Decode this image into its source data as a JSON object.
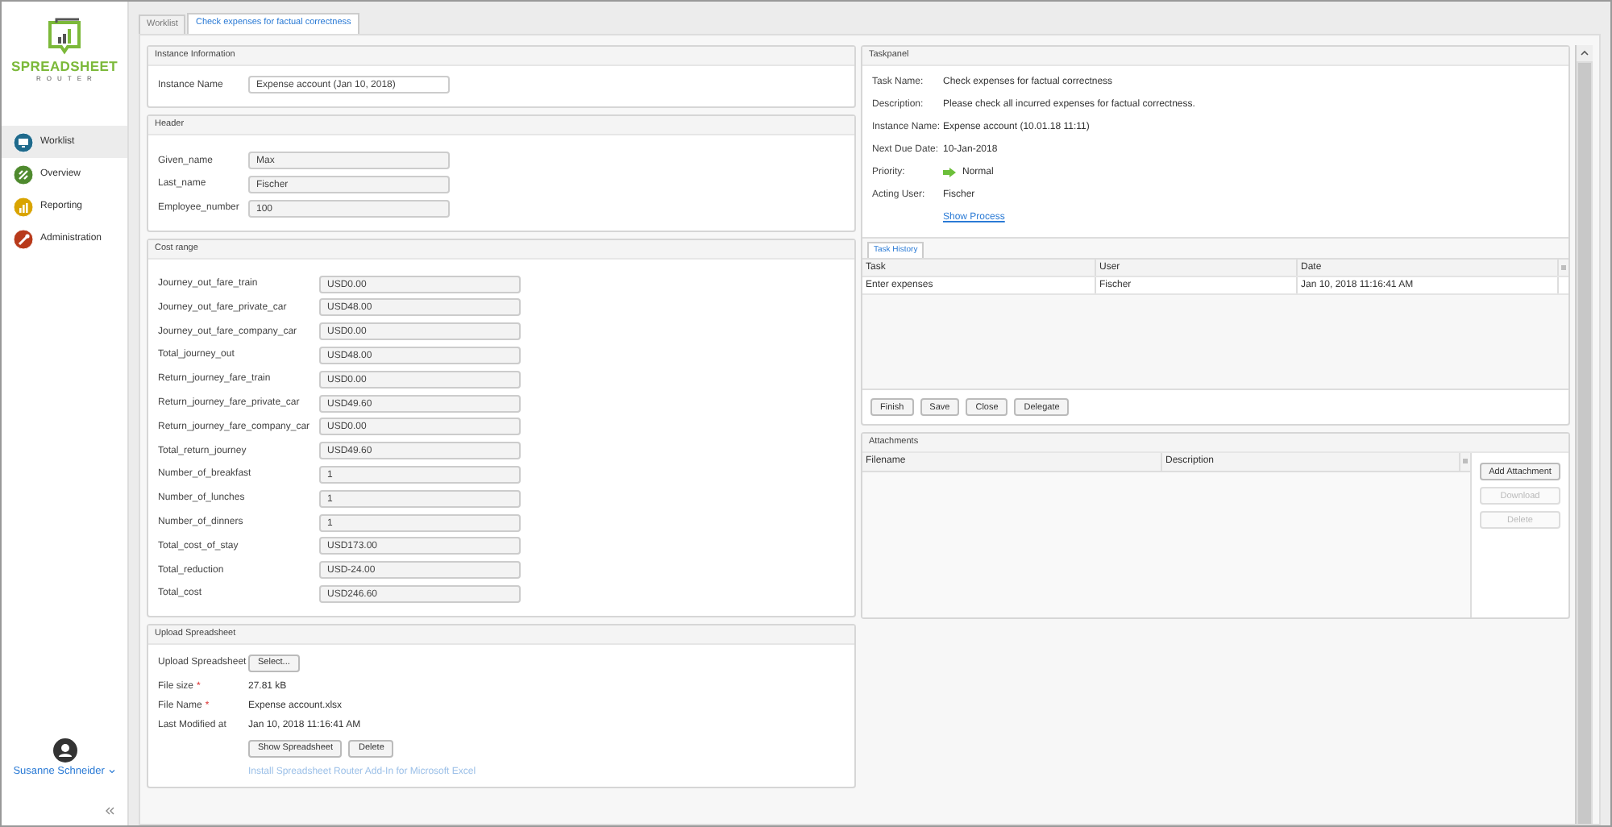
{
  "logo": {
    "title": "SPREADSHEET",
    "subtitle": "ROUTER"
  },
  "sidebar": {
    "items": [
      {
        "label": "Worklist",
        "color": "#1f6a8c",
        "selected": true
      },
      {
        "label": "Overview",
        "color": "#4f8a2e",
        "selected": false
      },
      {
        "label": "Reporting",
        "color": "#d9a400",
        "selected": false
      },
      {
        "label": "Administration",
        "color": "#b83a1b",
        "selected": false
      }
    ]
  },
  "user": {
    "name": "Susanne Schneider"
  },
  "tabs": [
    {
      "label": "Worklist",
      "selected": false
    },
    {
      "label": "Check expenses for factual correctness",
      "selected": true
    }
  ],
  "sections": [
    {
      "title": "Instance Information",
      "kind": "fields",
      "fields": [
        {
          "label": "Instance Name",
          "value": "Expense account (Jan 10, 2018)",
          "readonly": false
        }
      ]
    },
    {
      "title": "Header",
      "kind": "fields",
      "fields": [
        {
          "label": "Given_name",
          "value": "Max",
          "readonly": true
        },
        {
          "label": "Last_name",
          "value": "Fischer",
          "readonly": true
        },
        {
          "label": "Employee_number",
          "value": "100",
          "readonly": true
        }
      ]
    },
    {
      "title": "Cost range",
      "kind": "fields",
      "fields": [
        {
          "label": "Journey_out_fare_train",
          "value": "USD0.00",
          "readonly": true
        },
        {
          "label": "Journey_out_fare_private_car",
          "value": "USD48.00",
          "readonly": true
        },
        {
          "label": "Journey_out_fare_company_car",
          "value": "USD0.00",
          "readonly": true
        },
        {
          "label": "Total_journey_out",
          "value": "USD48.00",
          "readonly": true
        },
        {
          "label": "Return_journey_fare_train",
          "value": "USD0.00",
          "readonly": true
        },
        {
          "label": "Return_journey_fare_private_car",
          "value": "USD49.60",
          "readonly": true
        },
        {
          "label": "Return_journey_fare_company_car",
          "value": "USD0.00",
          "readonly": true
        },
        {
          "label": "Total_return_journey",
          "value": "USD49.60",
          "readonly": true
        },
        {
          "label": "Number_of_breakfast",
          "value": "1",
          "readonly": true
        },
        {
          "label": "Number_of_lunches",
          "value": "1",
          "readonly": true
        },
        {
          "label": "Number_of_dinners",
          "value": "1",
          "readonly": true
        },
        {
          "label": "Total_cost_of_stay",
          "value": "USD173.00",
          "readonly": true
        },
        {
          "label": "Total_reduction",
          "value": "USD-24.00",
          "readonly": true
        },
        {
          "label": "Total_cost",
          "value": "USD246.60",
          "readonly": true
        }
      ]
    },
    {
      "title": "Upload Spreadsheet",
      "kind": "upload",
      "rows": [
        {
          "label": "Upload Spreadsheet",
          "kind": "button",
          "value": "Select..."
        },
        {
          "label": "File size",
          "marker": "*",
          "kind": "text",
          "value": "27.81 kB"
        },
        {
          "label": "File Name",
          "marker": "*",
          "kind": "text",
          "value": "Expense account.xlsx"
        },
        {
          "label": "Last Modified at",
          "kind": "text",
          "value": "Jan 10, 2018 11:16:41 AM"
        }
      ],
      "buttons": [
        "Show Spreadsheet",
        "Delete"
      ],
      "link": "Install Spreadsheet Router Add-In for Microsoft Excel"
    }
  ],
  "taskpanel": {
    "title": "Taskpanel",
    "rows": [
      {
        "label": "Task Name:",
        "value": "Check expenses for factual correctness",
        "kind": "text"
      },
      {
        "label": "Description:",
        "value": "Please check all incurred expenses for factual correctness.",
        "kind": "text"
      },
      {
        "label": "Instance Name:",
        "value": "Expense account (10.01.18 11:11)",
        "kind": "text"
      },
      {
        "label": "Next Due Date:",
        "value": "10-Jan-2018",
        "kind": "text"
      },
      {
        "label": "Priority:",
        "value": "Normal",
        "kind": "priority"
      },
      {
        "label": "Acting User:",
        "value": "Fischer",
        "kind": "text"
      }
    ],
    "link": "Show Process",
    "history": {
      "tab": "Task History",
      "columns": [
        "Task",
        "User",
        "Date"
      ],
      "rows": [
        [
          "Enter expenses",
          "Fischer",
          "Jan 10, 2018 11:16:41 AM"
        ]
      ]
    },
    "buttons": [
      "Finish",
      "Save",
      "Close",
      "Delegate"
    ]
  },
  "attachments": {
    "title": "Attachments",
    "columns": [
      "Filename",
      "Description"
    ],
    "buttons": [
      {
        "label": "Add Attachment",
        "disabled": false
      },
      {
        "label": "Download",
        "disabled": true
      },
      {
        "label": "Delete",
        "disabled": true
      }
    ]
  }
}
